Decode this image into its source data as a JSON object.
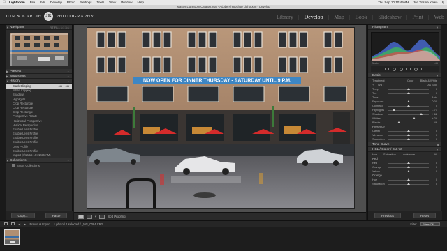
{
  "menubar": {
    "items": [
      "Lightroom",
      "File",
      "Edit",
      "Develop",
      "Photo",
      "Settings",
      "Tools",
      "View",
      "Window",
      "Help"
    ],
    "clock": "Thu Sep 10  10:49 AM",
    "user": "Jon Yoshie Kawa"
  },
  "window_title": "Master Lightroom Catalog.lrcat - Adobe Photoshop Lightroom - Develop",
  "identity_plate": {
    "text": "JON & KARLIE",
    "logo": "JK",
    "subtitle": "PHOTOGRAPHY"
  },
  "modules": [
    "Library",
    "Develop",
    "Map",
    "Book",
    "Slideshow",
    "Print",
    "Web"
  ],
  "left_panel": {
    "navigator": {
      "title": "Navigator",
      "zoom": "FIT  FILL  1:1  3:1"
    },
    "presets": "Presets",
    "snapshots": "Snapshots",
    "history": {
      "title": "History",
      "items": [
        {
          "label": "Black Clipping",
          "v1": "-46",
          "v2": "-46",
          "selected": true
        },
        {
          "label": "White Clipping",
          "v1": "",
          "v2": ""
        },
        {
          "label": "Shadows",
          "v1": "",
          "v2": ""
        },
        {
          "label": "Highlights",
          "v1": "",
          "v2": ""
        },
        {
          "label": "Crop Rectangle",
          "v1": "",
          "v2": ""
        },
        {
          "label": "Crop Rectangle",
          "v1": "",
          "v2": ""
        },
        {
          "label": "Crop Rectangle",
          "v1": "",
          "v2": ""
        },
        {
          "label": "Perspective Rotate",
          "v1": "",
          "v2": ""
        },
        {
          "label": "Horizontal Perspective",
          "v1": "",
          "v2": ""
        },
        {
          "label": "Vertical Perspective",
          "v1": "",
          "v2": ""
        },
        {
          "label": "Enable Lens Profile",
          "v1": "",
          "v2": ""
        },
        {
          "label": "Enable Lens Profile",
          "v1": "",
          "v2": ""
        },
        {
          "label": "Enable Lens Profile",
          "v1": "",
          "v2": ""
        },
        {
          "label": "Enable Lens Profile",
          "v1": "",
          "v2": ""
        },
        {
          "label": "Lens Profile",
          "v1": "",
          "v2": ""
        },
        {
          "label": "Enable Lens Profile",
          "v1": "",
          "v2": ""
        },
        {
          "label": "Import (8/10/15 10:22:26 AM)",
          "v1": "",
          "v2": ""
        }
      ]
    },
    "collections": {
      "title": "Collections",
      "item": "Smart Collections"
    },
    "buttons": {
      "copy": "Copy...",
      "paste": "Paste"
    }
  },
  "photo": {
    "banner": "NOW OPEN FOR DINNER THURSDAY - SATURDAY UNTIL 9 P.M."
  },
  "toolbar": {
    "soft_proofing": "Soft Proofing"
  },
  "right_panel": {
    "histogram_title": "Histogram",
    "hist_info_left": "Blacks",
    "hist_info_right": "-46",
    "basic_title": "Basic",
    "treatment_label": "Treatment :",
    "treatment_color": "Color",
    "treatment_bw": "Black & White",
    "wb_label": "WB :",
    "wb_value": "As Shot",
    "wb_rows": [
      {
        "label": "Temp",
        "value": "0",
        "pos": 0.5
      },
      {
        "label": "Tint",
        "value": "0",
        "pos": 0.5
      }
    ],
    "tone_label": "Tone",
    "tone_auto": "Auto",
    "tone_rows": [
      {
        "label": "Exposure",
        "value": "0.00",
        "pos": 0.5
      },
      {
        "label": "Contrast",
        "value": "0",
        "pos": 0.5
      },
      {
        "label": "Highlights",
        "value": "- 71",
        "pos": 0.15
      },
      {
        "label": "Shadows",
        "value": "+ 62",
        "pos": 0.81
      },
      {
        "label": "Whites",
        "value": "+ 28",
        "pos": 0.64
      },
      {
        "label": "Blacks",
        "value": "- 46",
        "pos": 0.27
      }
    ],
    "presence_label": "Presence",
    "presence_rows": [
      {
        "label": "Clarity",
        "value": "0",
        "pos": 0.5
      },
      {
        "label": "Vibrance",
        "value": "0",
        "pos": 0.5
      },
      {
        "label": "Saturation",
        "value": "0",
        "pos": 0.5
      }
    ],
    "tone_curve_title": "Tone Curve",
    "hsl_title": "HSL / Color / B & W",
    "hsl_tabs": [
      "Hue",
      "Saturation",
      "Luminance",
      "All"
    ],
    "hsl_red_label": "Red",
    "hsl_rows_top": [
      {
        "label": "Red",
        "value": "0",
        "pos": 0.5
      },
      {
        "label": "Orange",
        "value": "0",
        "pos": 0.5
      },
      {
        "label": "Yellow",
        "value": "0",
        "pos": 0.5
      }
    ],
    "hsl_orange_label": "Orange",
    "hsl_rows_bottom": [
      {
        "label": "Hue",
        "value": "0",
        "pos": 0.5
      },
      {
        "label": "Saturation",
        "value": "0",
        "pos": 0.5
      }
    ],
    "buttons": {
      "previous": "Previous",
      "reset": "Reset"
    }
  },
  "filmstrip": {
    "source": "Previous Import",
    "info": "1 photo / 1 selected / _MG_0084.CR2",
    "filter_label": "Filter :",
    "filter_value": "Filters Off"
  }
}
